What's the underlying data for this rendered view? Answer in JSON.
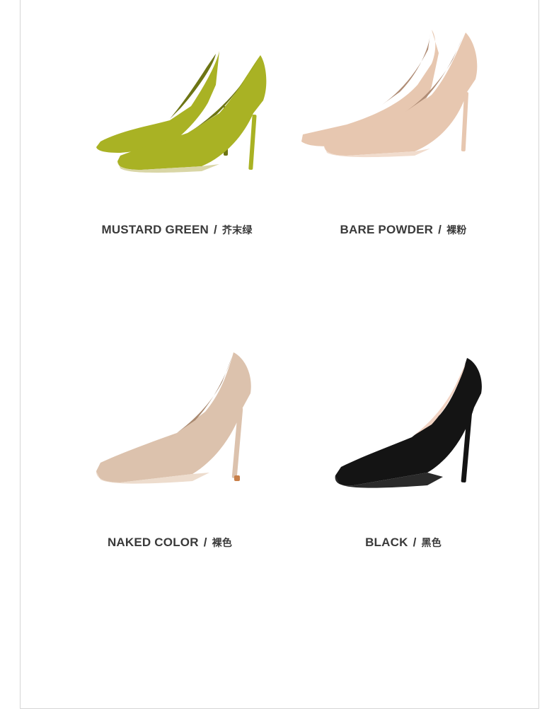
{
  "products": [
    {
      "name_en": "MUSTARD GREEN",
      "separator": "/",
      "name_zh": "芥末绿",
      "color": "#a9b224",
      "dark": "#6d7514",
      "sole": "#d9d6a6"
    },
    {
      "name_en": "BARE POWDER",
      "separator": "/",
      "name_zh": "裸粉",
      "color": "#e7c7b0",
      "dark": "#b08d76",
      "sole": "#f1dccd"
    },
    {
      "name_en": "NAKED COLOR",
      "separator": "/",
      "name_zh": "裸色",
      "color": "#dcc2ad",
      "dark": "#a98970",
      "sole": "#eddccd"
    },
    {
      "name_en": "BLACK",
      "separator": "/",
      "name_zh": "黑色",
      "color": "#141414",
      "dark": "#000000",
      "sole": "#2a2a2a"
    }
  ]
}
